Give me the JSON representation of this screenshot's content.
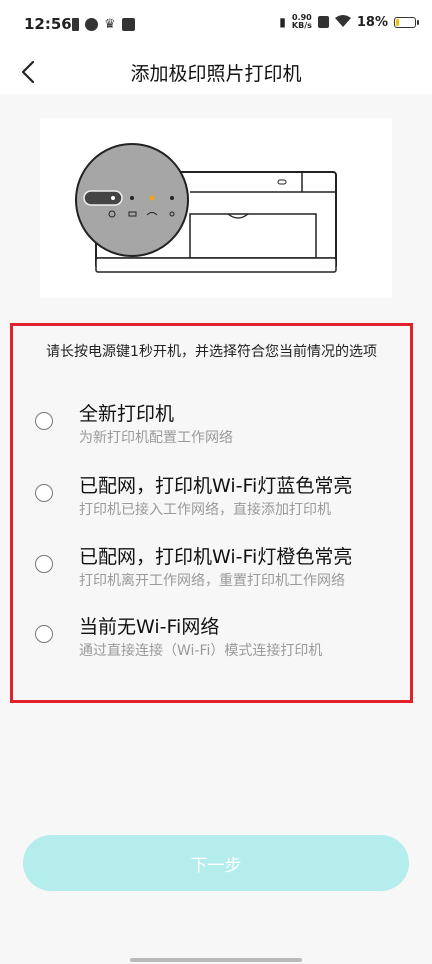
{
  "status_bar": {
    "time": "12:56",
    "net_speed_value": "0.90",
    "net_speed_unit": "KB/s",
    "battery": "18%",
    "battery_level": 0.18
  },
  "header": {
    "title": "添加极印照片打印机"
  },
  "section": {
    "prompt": "请长按电源键1秒开机，并选择符合您当前情况的选项",
    "options": [
      {
        "title": "全新打印机",
        "subtitle": "为新打印机配置工作网络"
      },
      {
        "title": "已配网，打印机Wi-Fi灯蓝色常亮",
        "subtitle": "打印机已接入工作网络，直接添加打印机"
      },
      {
        "title": "已配网，打印机Wi-Fi灯橙色常亮",
        "subtitle": "打印机离开工作网络，重置打印机工作网络"
      },
      {
        "title": "当前无Wi-Fi网络",
        "subtitle": "通过直接连接（Wi-Fi）模式连接打印机"
      }
    ]
  },
  "footer": {
    "next_label": "下一步"
  },
  "colors": {
    "highlight_border": "#e0202a",
    "next_button": "#b5ecec",
    "wifi_led": "#f2a51c",
    "battery_fill": "#f0c000"
  }
}
